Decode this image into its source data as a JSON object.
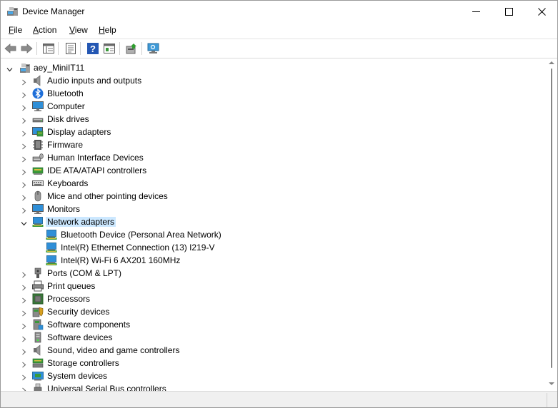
{
  "window": {
    "title": "Device Manager",
    "icon": "device-manager-icon"
  },
  "menu": {
    "file": "File",
    "action": "Action",
    "view": "View",
    "help": "Help"
  },
  "toolbar": {
    "icons": [
      "back-arrow-icon",
      "forward-arrow-icon",
      "console-tree-icon",
      "properties-icon",
      "help-icon",
      "show-hidden-icon",
      "update-driver-icon",
      "scan-hardware-icon"
    ]
  },
  "tree": {
    "root": {
      "label": "aey_MiniIT11",
      "icon": "computer-root-icon"
    },
    "categories": [
      {
        "label": "Audio inputs and outputs",
        "icon": "speaker-icon"
      },
      {
        "label": "Bluetooth",
        "icon": "bluetooth-icon"
      },
      {
        "label": "Computer",
        "icon": "monitor-icon"
      },
      {
        "label": "Disk drives",
        "icon": "disk-drive-icon"
      },
      {
        "label": "Display adapters",
        "icon": "display-adapter-icon"
      },
      {
        "label": "Firmware",
        "icon": "firmware-icon"
      },
      {
        "label": "Human Interface Devices",
        "icon": "hid-icon"
      },
      {
        "label": "IDE ATA/ATAPI controllers",
        "icon": "ide-controller-icon"
      },
      {
        "label": "Keyboards",
        "icon": "keyboard-icon"
      },
      {
        "label": "Mice and other pointing devices",
        "icon": "mouse-icon"
      },
      {
        "label": "Monitors",
        "icon": "monitor-icon"
      },
      {
        "label": "Network adapters",
        "icon": "network-adapter-icon",
        "expanded": true,
        "selected": true,
        "children": [
          {
            "label": "Bluetooth Device (Personal Area Network)",
            "icon": "network-adapter-icon"
          },
          {
            "label": "Intel(R) Ethernet Connection (13) I219-V",
            "icon": "network-adapter-icon"
          },
          {
            "label": "Intel(R) Wi-Fi 6 AX201 160MHz",
            "icon": "network-adapter-icon"
          }
        ]
      },
      {
        "label": "Ports (COM & LPT)",
        "icon": "port-icon"
      },
      {
        "label": "Print queues",
        "icon": "printer-icon"
      },
      {
        "label": "Processors",
        "icon": "processor-icon"
      },
      {
        "label": "Security devices",
        "icon": "security-device-icon"
      },
      {
        "label": "Software components",
        "icon": "software-component-icon"
      },
      {
        "label": "Software devices",
        "icon": "software-device-icon"
      },
      {
        "label": "Sound, video and game controllers",
        "icon": "speaker-icon"
      },
      {
        "label": "Storage controllers",
        "icon": "storage-controller-icon"
      },
      {
        "label": "System devices",
        "icon": "system-device-icon"
      },
      {
        "label": "Universal Serial Bus controllers",
        "icon": "usb-icon"
      }
    ]
  },
  "colors": {
    "selection": "#cce8ff",
    "accent": "#0078d4"
  }
}
